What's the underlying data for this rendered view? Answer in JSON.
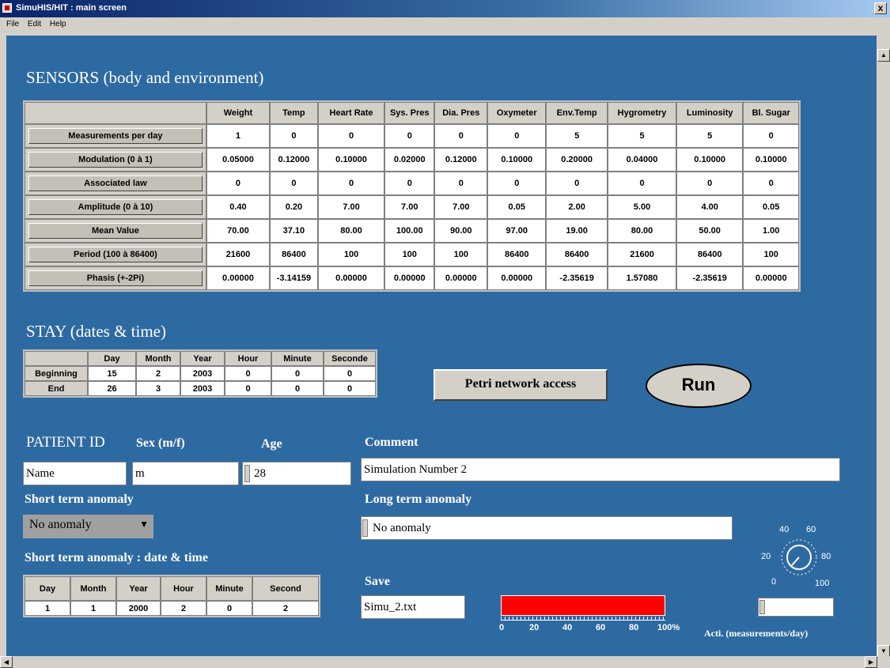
{
  "window": {
    "title": "SimuHIS/HIT : main screen",
    "close": "x"
  },
  "menu": [
    "File",
    "Edit",
    "Help"
  ],
  "sensors": {
    "heading": "SENSORS (body and environment)",
    "columns": [
      "Weight",
      "Temp",
      "Heart Rate",
      "Sys. Pres",
      "Dia. Pres",
      "Oxymeter",
      "Env.Temp",
      "Hygrometry",
      "Luminosity",
      "Bl. Sugar"
    ],
    "rows": [
      {
        "label": "Measurements per day",
        "values": [
          "1",
          "0",
          "0",
          "0",
          "0",
          "0",
          "5",
          "5",
          "5",
          "0"
        ]
      },
      {
        "label": "Modulation (0 à 1)",
        "values": [
          "0.05000",
          "0.12000",
          "0.10000",
          "0.02000",
          "0.12000",
          "0.10000",
          "0.20000",
          "0.04000",
          "0.10000",
          "0.10000"
        ]
      },
      {
        "label": "Associated law",
        "values": [
          "0",
          "0",
          "0",
          "0",
          "0",
          "0",
          "0",
          "0",
          "0",
          "0"
        ]
      },
      {
        "label": "Amplitude (0 à 10)",
        "values": [
          "0.40",
          "0.20",
          "7.00",
          "7.00",
          "7.00",
          "0.05",
          "2.00",
          "5.00",
          "4.00",
          "0.05"
        ]
      },
      {
        "label": "Mean Value",
        "values": [
          "70.00",
          "37.10",
          "80.00",
          "100.00",
          "90.00",
          "97.00",
          "19.00",
          "80.00",
          "50.00",
          "1.00"
        ]
      },
      {
        "label": "Period (100 à 86400)",
        "values": [
          "21600",
          "86400",
          "100",
          "100",
          "100",
          "86400",
          "86400",
          "21600",
          "86400",
          "100"
        ]
      },
      {
        "label": "Phasis (+-2Pi)",
        "values": [
          "0.00000",
          "-3.14159",
          "0.00000",
          "0.00000",
          "0.00000",
          "0.00000",
          "-2.35619",
          "1.57080",
          "-2.35619",
          "0.00000"
        ]
      }
    ]
  },
  "stay": {
    "heading": "STAY (dates & time)",
    "columns": [
      "Day",
      "Month",
      "Year",
      "Hour",
      "Minute",
      "Seconde"
    ],
    "rows": [
      {
        "label": "Beginning",
        "values": [
          "15",
          "2",
          "2003",
          "0",
          "0",
          "0"
        ]
      },
      {
        "label": "End",
        "values": [
          "26",
          "3",
          "2003",
          "0",
          "0",
          "0"
        ]
      }
    ]
  },
  "buttons": {
    "petri": "Petri network access",
    "run": "Run"
  },
  "patient": {
    "id_label": "PATIENT ID",
    "sex_label": "Sex (m/f)",
    "age_label": "Age",
    "name_value": "Name",
    "sex_value": "m",
    "age_value": "28",
    "comment_label": "Comment",
    "comment_value": "Simulation Number 2"
  },
  "anomaly": {
    "short_label": "Short term anomaly",
    "short_value": "No anomaly",
    "long_label": "Long term anomaly",
    "long_value": "No anomaly",
    "date_label": "Short term anomaly : date & time",
    "date_columns": [
      "Day",
      "Month",
      "Year",
      "Hour",
      "Minute",
      "Second"
    ],
    "date_values": [
      "1",
      "1",
      "2000",
      "2",
      "0",
      "2"
    ]
  },
  "save": {
    "label": "Save",
    "value": "Simu_2.txt"
  },
  "progress": {
    "percent": 100,
    "scale": [
      "0",
      "20",
      "40",
      "60",
      "80",
      "100%"
    ],
    "color": "#ff0000"
  },
  "activity": {
    "label": "Acti. (measurements/day)",
    "knob_scale": [
      "40",
      "60",
      "20",
      "80",
      "0",
      "100"
    ],
    "value": ""
  },
  "colors": {
    "background": "#2e6aa2",
    "button_face": "#d4d0c8"
  }
}
